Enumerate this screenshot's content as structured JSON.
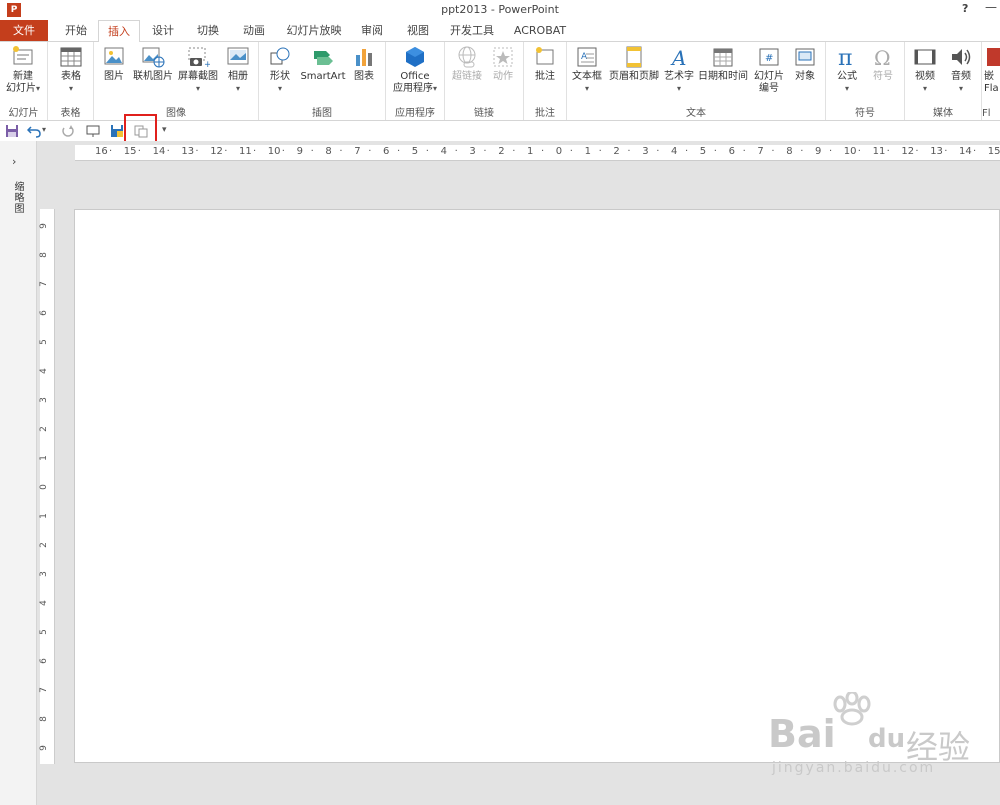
{
  "window": {
    "title": "ppt2013 - PowerPoint",
    "app_icon": "P",
    "help": "?",
    "minimize": "—"
  },
  "tabs": [
    "文件",
    "开始",
    "插入",
    "设计",
    "切换",
    "动画",
    "幻灯片放映",
    "审阅",
    "视图",
    "开发工具",
    "ACROBAT"
  ],
  "active_tab": "插入",
  "ribbon": {
    "groups": [
      {
        "label": "幻灯片",
        "buttons": [
          "新建\n幻灯片"
        ]
      },
      {
        "label": "表格",
        "buttons": [
          "表格"
        ]
      },
      {
        "label": "图像",
        "buttons": [
          "图片",
          "联机图片",
          "屏幕截图",
          "相册"
        ]
      },
      {
        "label": "插图",
        "buttons": [
          "形状",
          "SmartArt",
          "图表"
        ]
      },
      {
        "label": "应用程序",
        "buttons": [
          "Office\n应用程序"
        ]
      },
      {
        "label": "链接",
        "buttons": [
          "超链接",
          "动作"
        ]
      },
      {
        "label": "批注",
        "buttons": [
          "批注"
        ]
      },
      {
        "label": "文本",
        "buttons": [
          "文本框",
          "页眉和页脚",
          "艺术字",
          "日期和时间",
          "幻灯片\n编号",
          "对象"
        ]
      },
      {
        "label": "符号",
        "buttons": [
          "公式",
          "符号"
        ]
      },
      {
        "label": "媒体",
        "buttons": [
          "视频",
          "音频"
        ]
      },
      {
        "label": "Fl",
        "buttons": [
          "嵌\nFla"
        ]
      }
    ]
  },
  "side_panel": {
    "label": "缩略图"
  },
  "ruler": {
    "h": [
      "16",
      "15",
      "14",
      "13",
      "12",
      "11",
      "10",
      "9",
      "8",
      "7",
      "6",
      "5",
      "4",
      "3",
      "2",
      "1",
      "0",
      "1",
      "2",
      "3",
      "4",
      "5",
      "6",
      "7",
      "8",
      "9",
      "10",
      "11",
      "12",
      "13",
      "14",
      "15"
    ],
    "v": [
      "9",
      "8",
      "7",
      "6",
      "5",
      "4",
      "3",
      "2",
      "1",
      "0",
      "1",
      "2",
      "3",
      "4",
      "5",
      "6",
      "7",
      "8",
      "9"
    ]
  },
  "watermark": {
    "brand": "Bai",
    "brand2": "du",
    "cn": "经验",
    "url": "jingyan.baidu.com"
  }
}
